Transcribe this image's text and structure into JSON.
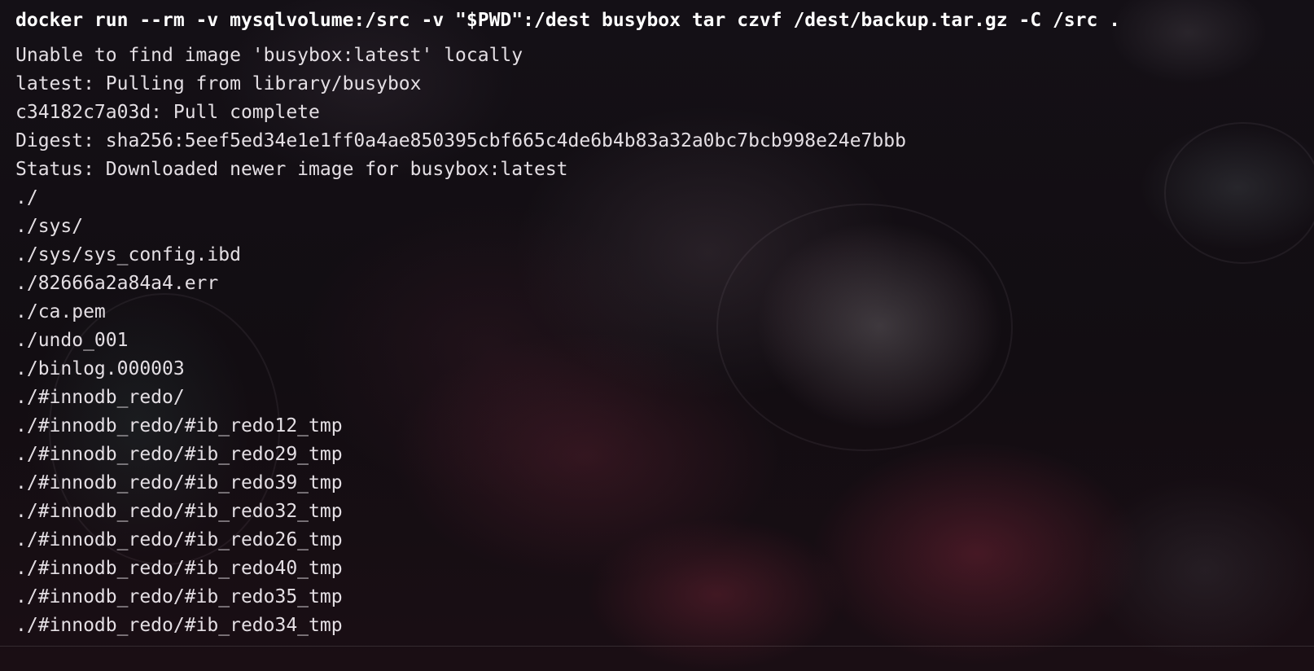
{
  "terminal": {
    "command": "docker run --rm -v mysqlvolume:/src -v \"$PWD\":/dest busybox tar czvf /dest/backup.tar.gz -C /src .",
    "output_lines": [
      "Unable to find image 'busybox:latest' locally",
      "latest: Pulling from library/busybox",
      "c34182c7a03d: Pull complete",
      "Digest: sha256:5eef5ed34e1e1ff0a4ae850395cbf665c4de6b4b83a32a0bc7bcb998e24e7bbb",
      "Status: Downloaded newer image for busybox:latest",
      "./",
      "./sys/",
      "./sys/sys_config.ibd",
      "./82666a2a84a4.err",
      "./ca.pem",
      "./undo_001",
      "./binlog.000003",
      "./#innodb_redo/",
      "./#innodb_redo/#ib_redo12_tmp",
      "./#innodb_redo/#ib_redo29_tmp",
      "./#innodb_redo/#ib_redo39_tmp",
      "./#innodb_redo/#ib_redo32_tmp",
      "./#innodb_redo/#ib_redo26_tmp",
      "./#innodb_redo/#ib_redo40_tmp",
      "./#innodb_redo/#ib_redo35_tmp",
      "./#innodb_redo/#ib_redo34_tmp"
    ]
  },
  "colors": {
    "text": "#e4dfe4",
    "command_text": "#ffffff",
    "background": "#120d12"
  }
}
